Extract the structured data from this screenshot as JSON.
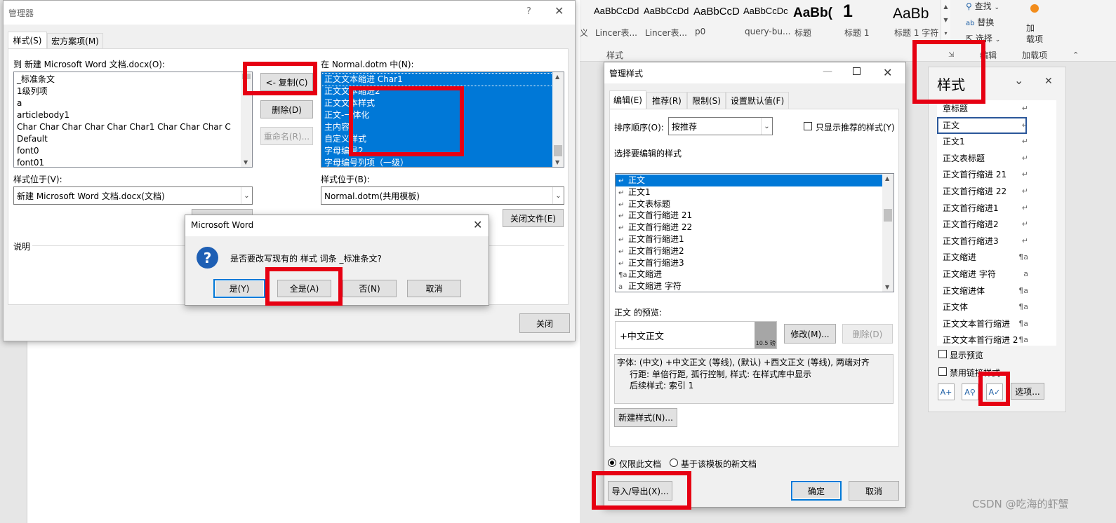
{
  "ribbon": {
    "gallery": [
      {
        "sample": "AaBbCcDd",
        "name": "Lincer表..."
      },
      {
        "sample": "AaBbCcDd",
        "name": "Lincer表..."
      },
      {
        "sample": "AaBbCcD",
        "name": "p0"
      },
      {
        "sample": "AaBbCcDc",
        "name": "query-bu..."
      },
      {
        "sample": "AaBb(",
        "name": "标题"
      },
      {
        "sample": "1",
        "name": "标题 1"
      },
      {
        "sample": "AaBb",
        "name": "标题 1 字符"
      }
    ],
    "first_stub": "义",
    "styles_group": "样式",
    "find": "查找",
    "replace": "替换",
    "select": "选择",
    "editing_group": "编辑",
    "addin_label": "加\n载项",
    "addins_group": "加载项"
  },
  "organizer": {
    "title": "管理器",
    "help": "?",
    "tabs": [
      "样式(S)",
      "宏方案项(M)"
    ],
    "left_label": "到 新建 Microsoft Word 文档.docx(O):",
    "left_items": [
      "_标准条文",
      "1级列项",
      "a",
      "articlebody1",
      "Char Char Char Char Char Char1 Char Char Char C",
      "Default",
      "font0",
      "font01"
    ],
    "copy_button": "<- 复制(C)",
    "delete_button": "删除(D)",
    "rename_button": "重命名(R)...",
    "right_label": "在 Normal.dotm 中(N):",
    "right_items": [
      "正文文本缩进 Char1",
      "正文文本缩进2",
      "正文文本样式",
      "正文-一体化",
      "主内容",
      "自定义样式",
      "字母编号2",
      "字母编号列项（一级）"
    ],
    "left_loc_label": "样式位于(V):",
    "left_loc_value": "新建 Microsoft Word 文档.docx(文档)",
    "right_loc_label": "样式位于(B):",
    "right_loc_value": "Normal.dotm(共用模板)",
    "close_file_button": "关闭文件(E)",
    "desc_label": "说明",
    "close_button": "关闭"
  },
  "msgbox": {
    "title": "Microsoft Word",
    "message": "是否要改写现有的 样式 词条 _标准条文?",
    "buttons": [
      "是(Y)",
      "全是(A)",
      "否(N)",
      "取消"
    ]
  },
  "manage": {
    "title": "管理样式",
    "tabs": [
      "编辑(E)",
      "推荐(R)",
      "限制(S)",
      "设置默认值(F)"
    ],
    "sort_label": "排序顺序(O):",
    "sort_value": "按推荐",
    "recommended_only": "只显示推荐的样式(Y)",
    "select_label": "选择要编辑的样式",
    "items": [
      {
        "mk": "↵",
        "name": "正文"
      },
      {
        "mk": "↵",
        "name": "正文1"
      },
      {
        "mk": "↵",
        "name": "正文表标题"
      },
      {
        "mk": "↵",
        "name": "正文首行缩进 21"
      },
      {
        "mk": "↵",
        "name": "正文首行缩进 22"
      },
      {
        "mk": "↵",
        "name": "正文首行缩进1"
      },
      {
        "mk": "↵",
        "name": "正文首行缩进2"
      },
      {
        "mk": "↵",
        "name": "正文首行缩进3"
      },
      {
        "mk": "¶a",
        "name": "正文缩进"
      },
      {
        "mk": "a",
        "name": "正文缩进 字符"
      }
    ],
    "preview_label": "正文 的预览:",
    "preview_text": "+中文正文",
    "preview_size": "10.5 磅",
    "modify_button": "修改(M)...",
    "delete_button": "删除(D)",
    "desc_lines": [
      "字体: (中文) +中文正文 (等线), (默认) +西文正文 (等线), 两端对齐",
      "行距: 单倍行距, 孤行控制, 样式: 在样式库中显示",
      "后续样式: 索引 1"
    ],
    "new_style_button": "新建样式(N)...",
    "radio_doc": "仅限此文档",
    "radio_template": "基于该模板的新文档",
    "import_export_button": "导入/导出(X)...",
    "ok_button": "确定",
    "cancel_button": "取消"
  },
  "styles_pane": {
    "title": "样式",
    "items": [
      {
        "name": "章标题",
        "mk": "↵"
      },
      {
        "name": "正文",
        "mk": "↵"
      },
      {
        "name": "正文1",
        "mk": "↵"
      },
      {
        "name": "正文表标题",
        "mk": "↵"
      },
      {
        "name": "正文首行缩进 21",
        "mk": "↵"
      },
      {
        "name": "正文首行缩进 22",
        "mk": "↵"
      },
      {
        "name": "正文首行缩进1",
        "mk": "↵"
      },
      {
        "name": "正文首行缩进2",
        "mk": "↵"
      },
      {
        "name": "正文首行缩进3",
        "mk": "↵"
      },
      {
        "name": "正文缩进",
        "mk": "¶a"
      },
      {
        "name": "正文缩进 字符",
        "mk": "a"
      },
      {
        "name": "正文缩进体",
        "mk": "¶a"
      },
      {
        "name": "正文体",
        "mk": "¶a"
      },
      {
        "name": "正文文本首行缩进",
        "mk": "¶a"
      },
      {
        "name": "正文文本首行缩进 2",
        "mk": "¶a"
      }
    ],
    "show_preview": "显示预览",
    "disable_linked": "禁用链接样式",
    "options_button": "选项..."
  },
  "watermark": "CSDN @吃海的虾蟹"
}
